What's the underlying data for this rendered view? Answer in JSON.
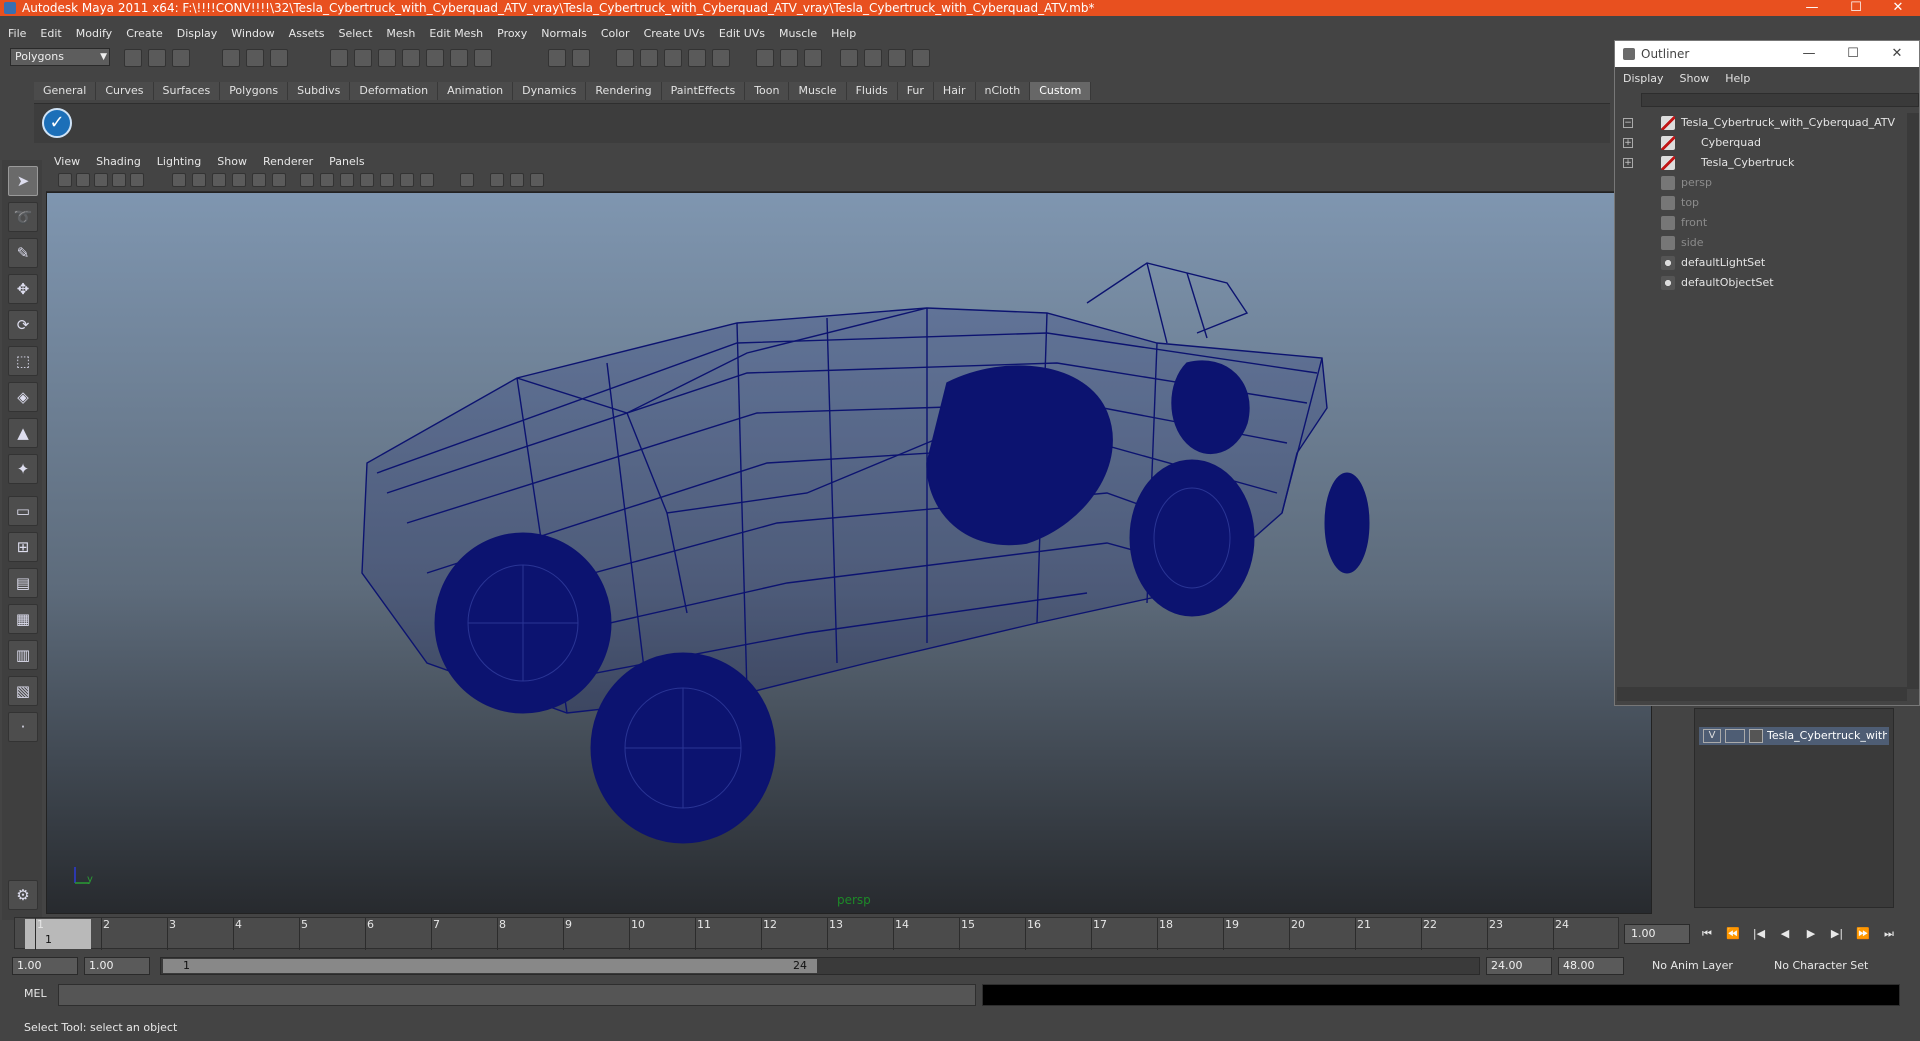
{
  "window": {
    "title": "Autodesk Maya 2011 x64: F:\\!!!!CONV!!!!\\32\\Tesla_Cybertruck_with_Cyberquad_ATV_vray\\Tesla_Cybertruck_with_Cyberquad_ATV_vray\\Tesla_Cybertruck_with_Cyberquad_ATV.mb*",
    "minimize": "—",
    "maximize": "☐",
    "close": "✕"
  },
  "menubar": [
    "File",
    "Edit",
    "Modify",
    "Create",
    "Display",
    "Window",
    "Assets",
    "Select",
    "Mesh",
    "Edit Mesh",
    "Proxy",
    "Normals",
    "Color",
    "Create UVs",
    "Edit UVs",
    "Muscle",
    "Help"
  ],
  "statusline": {
    "mode": "Polygons"
  },
  "shelf": {
    "tabs": [
      "General",
      "Curves",
      "Surfaces",
      "Polygons",
      "Subdivs",
      "Deformation",
      "Animation",
      "Dynamics",
      "Rendering",
      "PaintEffects",
      "Toon",
      "Muscle",
      "Fluids",
      "Fur",
      "Hair",
      "nCloth",
      "Custom"
    ],
    "active_tab": "Custom",
    "button_icon": "checkmark-icon"
  },
  "viewport": {
    "menu": [
      "View",
      "Shading",
      "Lighting",
      "Show",
      "Renderer",
      "Panels"
    ],
    "camera": "persp",
    "wire_color": "#0c1370"
  },
  "outliner": {
    "title": "Outliner",
    "menu": [
      "Display",
      "Show",
      "Help"
    ],
    "items": [
      {
        "label": "Tesla_Cybertruck_with_Cyberquad_ATV",
        "type": "mesh",
        "expander": "−"
      },
      {
        "label": "Cyberquad",
        "type": "mesh",
        "expander": "+"
      },
      {
        "label": "Tesla_Cybertruck",
        "type": "mesh",
        "expander": "+"
      },
      {
        "label": "persp",
        "type": "camera"
      },
      {
        "label": "top",
        "type": "camera"
      },
      {
        "label": "front",
        "type": "camera"
      },
      {
        "label": "side",
        "type": "camera"
      },
      {
        "label": "defaultLightSet",
        "type": "set"
      },
      {
        "label": "defaultObjectSet",
        "type": "set"
      }
    ]
  },
  "layer": {
    "visible": "V",
    "name": "Tesla_Cybertruck_with_C"
  },
  "timeline": {
    "ticks": [
      "1",
      "2",
      "3",
      "4",
      "5",
      "6",
      "7",
      "8",
      "9",
      "10",
      "11",
      "12",
      "13",
      "14",
      "15",
      "16",
      "17",
      "18",
      "19",
      "20",
      "21",
      "22",
      "23",
      "24"
    ],
    "current_frame": "1",
    "frame_field": "1.00"
  },
  "playback": [
    "⏮",
    "⏪",
    "|◀",
    "◀",
    "▶",
    "▶|",
    "⏩",
    "⏭"
  ],
  "range": {
    "start": "1.00",
    "range_start": "1.00",
    "handle_start": "1",
    "handle_end": "24",
    "range_end": "24.00",
    "end": "48.00",
    "anim_layer": "No Anim Layer",
    "char_set": "No Character Set"
  },
  "command": {
    "label": "MEL"
  },
  "help_line": "Select Tool: select an object",
  "colors": {
    "title_bar": "#e8501f",
    "active_tab": "#676767"
  }
}
